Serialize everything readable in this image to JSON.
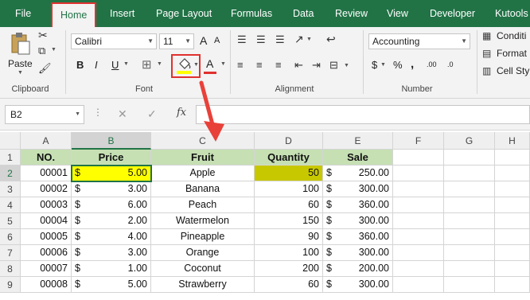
{
  "menu": {
    "tabs": [
      "File",
      "Home",
      "Insert",
      "Page Layout",
      "Formulas",
      "Data",
      "Review",
      "View",
      "Developer",
      "Kutools"
    ],
    "active": "Home"
  },
  "ribbon": {
    "clipboard": {
      "paste_label": "Paste",
      "group_label": "Clipboard"
    },
    "font": {
      "font_name": "Calibri",
      "font_size": "11",
      "group_label": "Font",
      "bold": "B",
      "italic": "I",
      "underline": "U",
      "grow": "A",
      "shrink": "A",
      "font_color_letter": "A",
      "fill_color": "#ffff00",
      "font_color": "#e0312f"
    },
    "alignment": {
      "group_label": "Alignment"
    },
    "number": {
      "format": "Accounting",
      "group_label": "Number",
      "currency": "$",
      "percent": "%",
      "comma": ",",
      "inc_decimal": ".00",
      "dec_decimal": ".0"
    },
    "styles": {
      "conditional": "Conditi",
      "format": "Format",
      "cell_styles": "Cell Sty"
    }
  },
  "formula_bar": {
    "name_box": "B2",
    "fx": "fx",
    "formula": ""
  },
  "sheet": {
    "columns": [
      "A",
      "B",
      "C",
      "D",
      "E",
      "F",
      "G",
      "H"
    ],
    "rows": [
      "1",
      "2",
      "3",
      "4",
      "5",
      "6",
      "7",
      "8",
      "9"
    ],
    "header": [
      "NO.",
      "Price",
      "Fruit",
      "Quantity",
      "Sale"
    ],
    "data": [
      {
        "no": "00001",
        "price": "5.00",
        "fruit": "Apple",
        "qty": "50",
        "sale": "250.00"
      },
      {
        "no": "00002",
        "price": "3.00",
        "fruit": "Banana",
        "qty": "100",
        "sale": "300.00"
      },
      {
        "no": "00003",
        "price": "6.00",
        "fruit": "Peach",
        "qty": "60",
        "sale": "360.00"
      },
      {
        "no": "00004",
        "price": "2.00",
        "fruit": "Watermelon",
        "qty": "150",
        "sale": "300.00"
      },
      {
        "no": "00005",
        "price": "4.00",
        "fruit": "Pineapple",
        "qty": "90",
        "sale": "360.00"
      },
      {
        "no": "00006",
        "price": "3.00",
        "fruit": "Orange",
        "qty": "100",
        "sale": "300.00"
      },
      {
        "no": "00007",
        "price": "1.00",
        "fruit": "Coconut",
        "qty": "200",
        "sale": "200.00"
      },
      {
        "no": "00008",
        "price": "5.00",
        "fruit": "Strawberry",
        "qty": "60",
        "sale": "300.00"
      }
    ],
    "currency_symbol": "$",
    "header_fill": "#c6e0b4",
    "highlight_b2": "#ffff00",
    "highlight_d2": "#c8c800"
  }
}
